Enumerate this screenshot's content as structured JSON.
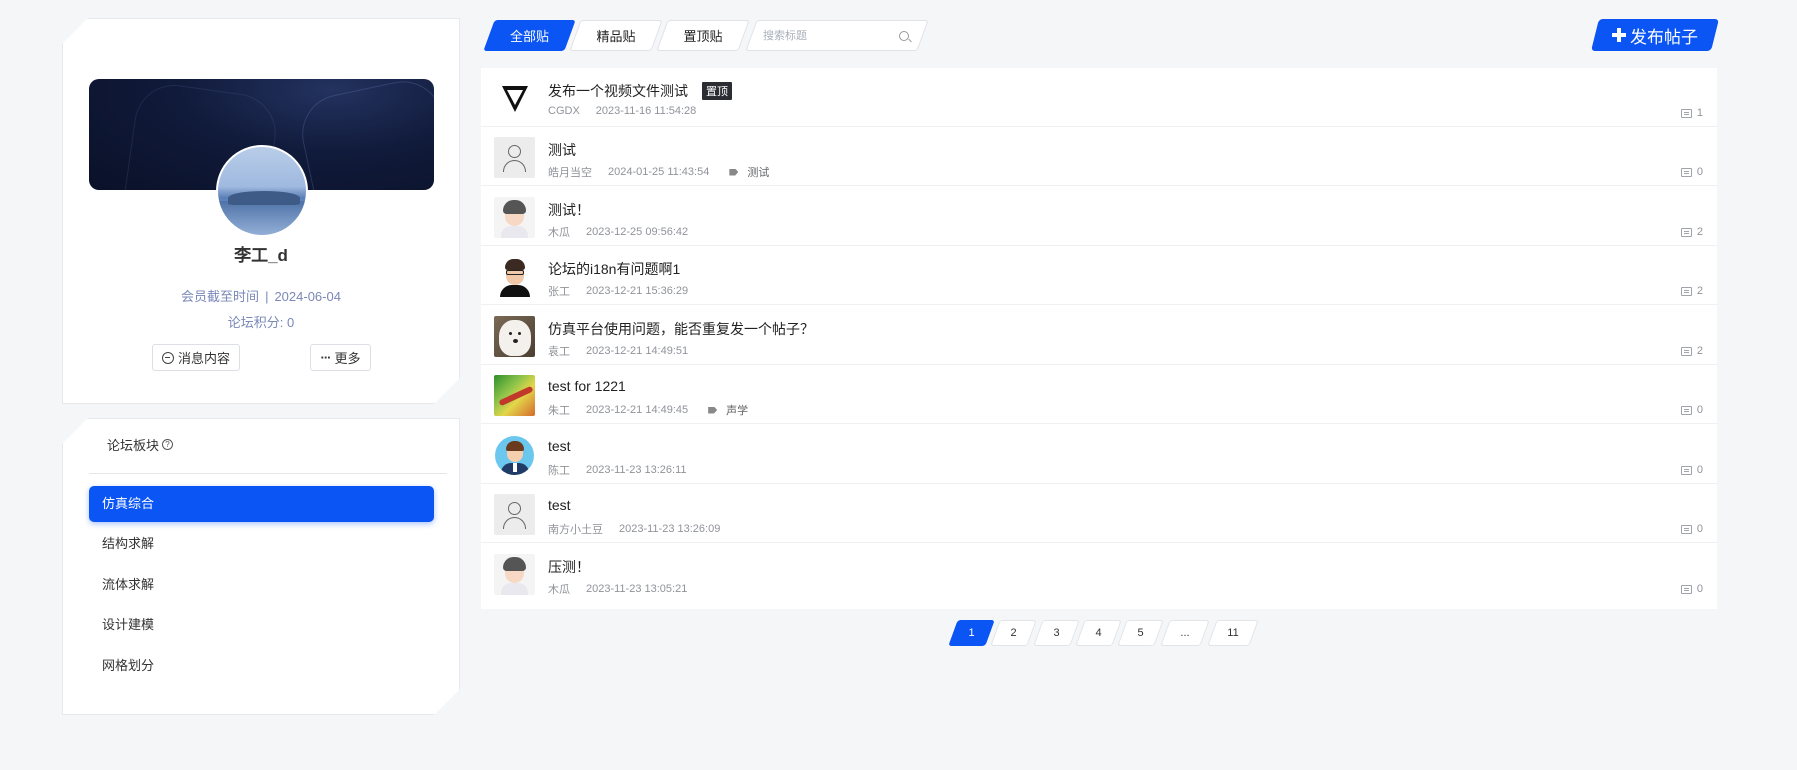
{
  "profile": {
    "name": "李工_d",
    "member_label": "会员截至时间",
    "member_sep": "|",
    "member_date": "2024-06-04",
    "points_text": "论坛积分: 0",
    "message_button": "消息内容",
    "more_button": "更多",
    "more_icon": "ellipsis-icon",
    "message_icon": "message-icon"
  },
  "boards": {
    "title": "论坛板块",
    "help_icon": "?",
    "items": [
      {
        "label": "仿真综合",
        "active": true
      },
      {
        "label": "结构求解",
        "active": false
      },
      {
        "label": "流体求解",
        "active": false
      },
      {
        "label": "设计建模",
        "active": false
      },
      {
        "label": "网格划分",
        "active": false
      }
    ]
  },
  "toolbar": {
    "tabs": [
      {
        "label": "全部贴",
        "active": true
      },
      {
        "label": "精品贴",
        "active": false
      },
      {
        "label": "置顶贴",
        "active": false
      }
    ],
    "search_placeholder": "搜索标题",
    "search_value": "",
    "post_button": "发布帖子"
  },
  "posts": [
    {
      "title": "发布一个视频文件测试",
      "badge": "置顶",
      "author": "CGDX",
      "time": "2023-11-16 11:54:28",
      "tag": "",
      "comments": "1",
      "avatar": "logo"
    },
    {
      "title": "测试",
      "badge": "",
      "author": "皓月当空",
      "time": "2024-01-25 11:43:54",
      "tag": "测试",
      "comments": "0",
      "avatar": "default"
    },
    {
      "title": "测试！",
      "badge": "",
      "author": "木瓜",
      "time": "2023-12-25 09:56:42",
      "tag": "",
      "comments": "2",
      "avatar": "cartoon"
    },
    {
      "title": "论坛的i18n有问题啊1",
      "badge": "",
      "author": "张工",
      "time": "2023-12-21 15:36:29",
      "tag": "",
      "comments": "2",
      "avatar": "glasses"
    },
    {
      "title": "仿真平台使用问题，能否重复发一个帖子？",
      "badge": "",
      "author": "袁工",
      "time": "2023-12-21 14:49:51",
      "tag": "",
      "comments": "2",
      "avatar": "dog"
    },
    {
      "title": "test for 1221",
      "badge": "",
      "author": "朱工",
      "time": "2023-12-21 14:49:45",
      "tag": "声学",
      "comments": "0",
      "avatar": "green"
    },
    {
      "title": "test",
      "badge": "",
      "author": "陈工",
      "time": "2023-11-23 13:26:11",
      "tag": "",
      "comments": "0",
      "avatar": "blue"
    },
    {
      "title": "test",
      "badge": "",
      "author": "南方小土豆",
      "time": "2023-11-23 13:26:09",
      "tag": "",
      "comments": "0",
      "avatar": "default"
    },
    {
      "title": "压测！",
      "badge": "",
      "author": "木瓜",
      "time": "2023-11-23 13:05:21",
      "tag": "",
      "comments": "0",
      "avatar": "cartoon"
    }
  ],
  "pagination": {
    "pages": [
      "1",
      "2",
      "3",
      "4",
      "5",
      "...",
      "11"
    ],
    "current": "1"
  },
  "colors": {
    "accent": "#0b55f5",
    "background": "#f5f6f8",
    "muted_text": "#909399",
    "member_text": "#7a88b8"
  }
}
